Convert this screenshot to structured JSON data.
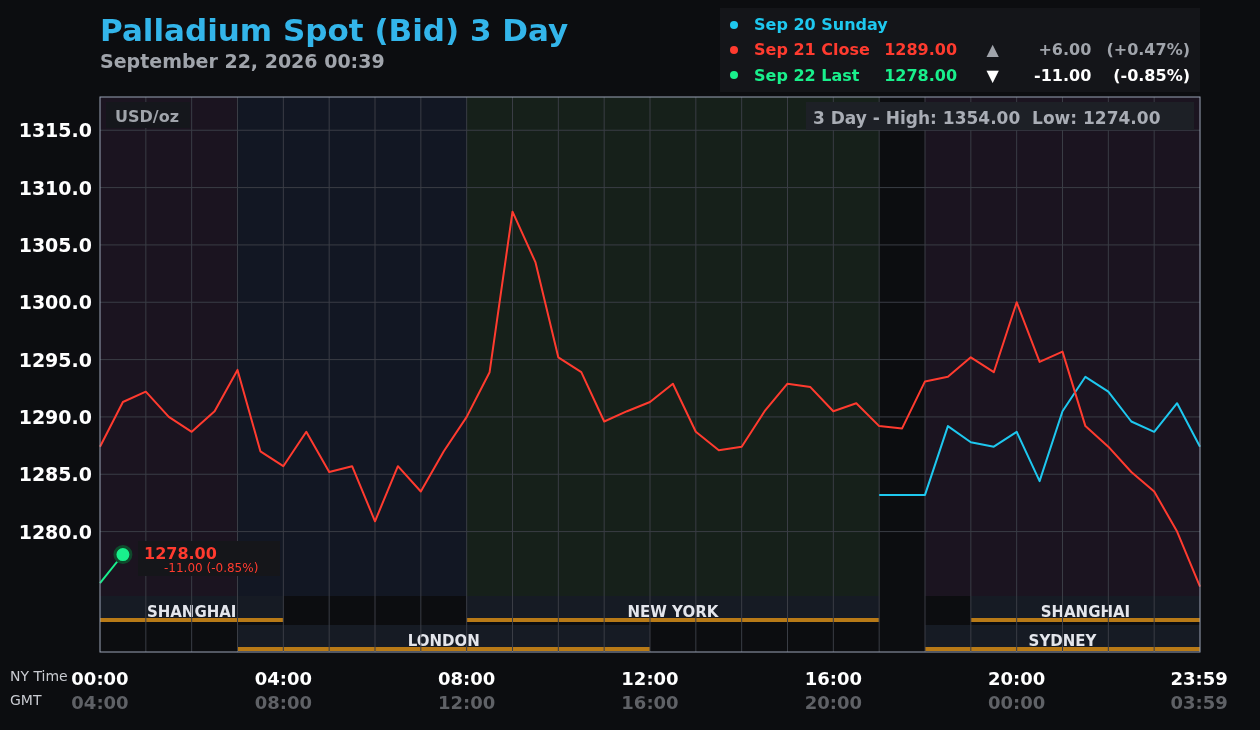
{
  "header": {
    "title": "Palladium Spot (Bid) 3 Day",
    "date": "September 22, 2026 00:39"
  },
  "legend": [
    {
      "kind": "name"
    },
    {
      "kind": "quote",
      "price": "1289.00",
      "arrow": "▲",
      "rising": true,
      "change": "+6.00",
      "percent": "(+0.47%)"
    },
    {
      "kind": "quote",
      "price": "1278.00",
      "arrow": "▼",
      "rising": false,
      "change": "-11.00",
      "percent": "(-0.85%)"
    }
  ],
  "chart": {
    "range_note": "3 Day - High: 1354.00  Low: 1274.00",
    "last_price": "1278.00",
    "last_change": "-11.00 (-0.85%)",
    "time_label": "NY Time",
    "gmt_label": "GMT",
    "gmt_ticks": [
      "04:00",
      "08:00",
      "12:00",
      "16:00",
      "20:00",
      "00:00",
      "03:59"
    ],
    "chart_data": {
      "type": "line",
      "ylabel": "USD/oz",
      "grid": true,
      "x": [
        0,
        0.5,
        1,
        1.5,
        2,
        2.5,
        3,
        3.5,
        4,
        4.5,
        5,
        5.5,
        6,
        6.5,
        7,
        7.5,
        8,
        8.5,
        9,
        9.5,
        10,
        10.5,
        11,
        11.5,
        12,
        12.5,
        13,
        13.5,
        14,
        14.5,
        15,
        15.5,
        16,
        16.5,
        17,
        17.5,
        18,
        18.5,
        19,
        19.5,
        20,
        20.5,
        21,
        21.5,
        22,
        22.5,
        23,
        23.5,
        24
      ],
      "series": [
        {
          "name": "Sep 20 Sunday",
          "color": "#1ec8ef",
          "values": [
            null,
            null,
            null,
            null,
            null,
            null,
            null,
            null,
            null,
            null,
            null,
            null,
            null,
            null,
            null,
            null,
            null,
            null,
            null,
            null,
            null,
            null,
            null,
            null,
            null,
            null,
            null,
            null,
            null,
            null,
            null,
            null,
            null,
            null,
            1283.2,
            1283.2,
            1283.2,
            1289.2,
            1287.8,
            1287.4,
            1288.7,
            1284.4,
            1290.5,
            1293.5,
            1292.2,
            1289.6,
            1288.7,
            1291.2,
            1287.4
          ]
        },
        {
          "name": "Sep 21 Close",
          "color": "#ff3b2f",
          "values": [
            1287.4,
            1291.3,
            1292.2,
            1290,
            1288.7,
            1290.5,
            1294.1,
            1287,
            1285.7,
            1288.7,
            1285.2,
            1285.7,
            1280.9,
            1285.7,
            1283.5,
            1287,
            1290,
            1293.9,
            1307.9,
            1303.5,
            1295.2,
            1293.9,
            1289.6,
            1290.5,
            1291.3,
            1292.9,
            1288.7,
            1287.1,
            1287.4,
            1290.5,
            1292.9,
            1292.6,
            1290.5,
            1291.2,
            1289.2,
            1289,
            1293.1,
            1293.5,
            1295.2,
            1293.9,
            1300,
            1294.8,
            1295.7,
            1289.2,
            1287.4,
            1285.2,
            1283.5,
            1280,
            1275.2
          ]
        },
        {
          "name": "Sep 22 Last",
          "color": "#19f08c",
          "values": [
            1275.5,
            1278,
            null,
            null,
            null,
            null,
            null,
            null,
            null,
            null,
            null,
            null,
            null,
            null,
            null,
            null,
            null,
            null,
            null,
            null,
            null,
            null,
            null,
            null,
            null,
            null,
            null,
            null,
            null,
            null,
            null,
            null,
            null,
            null,
            null,
            null,
            null,
            null,
            null,
            null,
            null,
            null,
            null,
            null,
            null,
            null,
            null,
            null,
            null
          ]
        }
      ],
      "xlim": [
        0,
        24
      ],
      "ylim": [
        1269.5,
        1317.9
      ],
      "xticks": [
        {
          "value": 0,
          "label": "00:00"
        },
        {
          "value": 4,
          "label": "04:00"
        },
        {
          "value": 8,
          "label": "08:00"
        },
        {
          "value": 12,
          "label": "12:00"
        },
        {
          "value": 16,
          "label": "16:00"
        },
        {
          "value": 20,
          "label": "20:00"
        },
        {
          "value": 23.983,
          "label": "23:59"
        }
      ],
      "yticks": [
        {
          "value": 1280,
          "label": "1280.0"
        },
        {
          "value": 1285,
          "label": "1285.0"
        },
        {
          "value": 1290,
          "label": "1290.0"
        },
        {
          "value": 1295,
          "label": "1295.0"
        },
        {
          "value": 1300,
          "label": "1300.0"
        },
        {
          "value": 1305,
          "label": "1305.0"
        },
        {
          "value": 1310,
          "label": "1310.0"
        },
        {
          "value": 1315,
          "label": "1315.0"
        }
      ]
    },
    "sessions": [
      "SHANGHAI",
      "LONDON",
      "NEW YORK",
      "SHANGHAI",
      "SYDNEY"
    ]
  }
}
